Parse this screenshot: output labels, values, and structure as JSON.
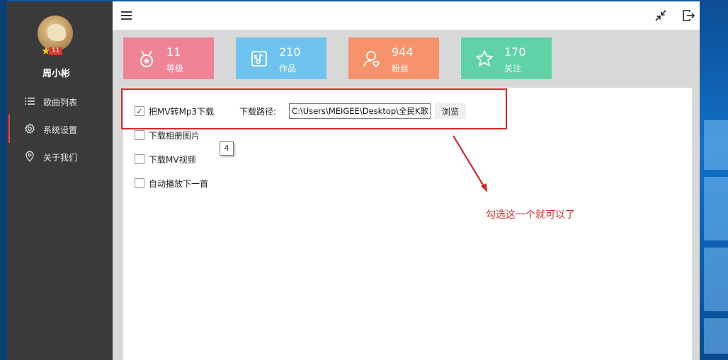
{
  "user": {
    "name": "周小彬",
    "level_badge": "11"
  },
  "sidebar": {
    "items": [
      {
        "label": "歌曲列表",
        "icon": "list-icon",
        "active": false
      },
      {
        "label": "系统设置",
        "icon": "gear-icon",
        "active": true
      },
      {
        "label": "关于我们",
        "icon": "location-pin-icon",
        "active": false
      }
    ]
  },
  "topbar": {
    "menu_icon": "hamburger-icon",
    "minimize_icon": "shrink-icon",
    "logout_icon": "logout-icon"
  },
  "stats": [
    {
      "value": "11",
      "label": "等级",
      "icon": "medal-icon",
      "color": "#f08497"
    },
    {
      "value": "210",
      "label": "作品",
      "icon": "music-note-icon",
      "color": "#6fc4ef"
    },
    {
      "value": "944",
      "label": "粉丝",
      "icon": "user-heart-icon",
      "color": "#f7936c"
    },
    {
      "value": "170",
      "label": "关注",
      "icon": "star-icon",
      "color": "#5fd3a5"
    }
  ],
  "settings": {
    "options": [
      {
        "label": "把MV转Mp3下载",
        "checked": true
      },
      {
        "label": "下载相册图片",
        "checked": false
      },
      {
        "label": "下载MV视频",
        "checked": false
      },
      {
        "label": "自动播放下一首",
        "checked": false
      }
    ],
    "path_label": "下载路径:",
    "path_value": "C:\\Users\\MEIGEE\\Desktop\\全民K歌",
    "browse_label": "浏览",
    "tooltip": "4"
  },
  "annotation": {
    "text": "勾选这一个就可以了",
    "color": "#d22b2b"
  },
  "colors": {
    "sidebar_bg": "#3a3a3a",
    "active_indicator": "#e8434f",
    "window_bg": "#d9d9d9"
  }
}
